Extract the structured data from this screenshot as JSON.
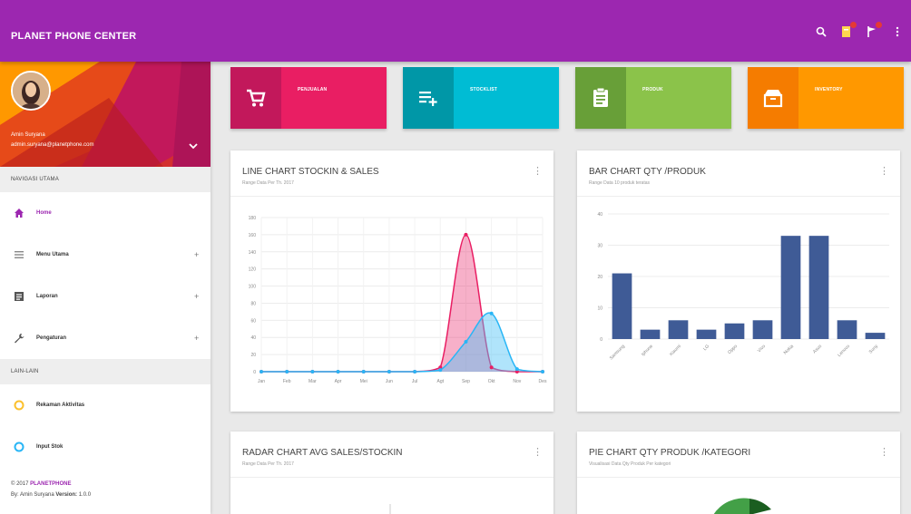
{
  "app": {
    "title": "PLANET PHONE CENTER"
  },
  "topbar": {
    "icons": [
      "search-icon",
      "notification-icon",
      "flag-icon",
      "more-vert-icon"
    ]
  },
  "user": {
    "name": "Amin Suryana",
    "email": "admin.suryana@planetphone.com"
  },
  "sidebar": {
    "section1": "NAVIGASI UTAMA",
    "items": [
      {
        "label": "Home",
        "icon": "home-icon"
      },
      {
        "label": "Menu Utama",
        "icon": "menu-icon",
        "expand": "+"
      },
      {
        "label": "Laporan",
        "icon": "report-icon",
        "expand": "+"
      },
      {
        "label": "Pengaturan",
        "icon": "wrench-icon",
        "expand": "+"
      }
    ],
    "section2": "LAIN-LAIN",
    "others": [
      {
        "label": "Rekaman Aktivitas",
        "icon": "circle-yellow-icon"
      },
      {
        "label": "Input Stok",
        "icon": "circle-blue-icon"
      }
    ],
    "footer_copy": "© 2017 ",
    "footer_brand": "PLANETPHONE",
    "footer_by": "By: Amin Suryana ",
    "footer_version_label": "Version: ",
    "footer_version": "1.0.0"
  },
  "tiles": [
    {
      "label": "PENJUALAN",
      "color": "#e91e63",
      "dark": "#c2185b",
      "icon": "cart-icon"
    },
    {
      "label": "STOCKLIST",
      "color": "#00bcd4",
      "dark": "#0097a7",
      "icon": "playlist-add-icon"
    },
    {
      "label": "PRODUK",
      "color": "#8bc34a",
      "dark": "#689f38",
      "icon": "clipboard-icon"
    },
    {
      "label": "INVENTORY",
      "color": "#ff9800",
      "dark": "#f57c00",
      "icon": "inventory-box-icon"
    }
  ],
  "cards": {
    "line": {
      "title": "LINE CHART STOCKIN & SALES",
      "subtitle": "Range Data Per Th. 2017"
    },
    "bar": {
      "title": "BAR CHART QTY /PRODUK",
      "subtitle": "Range Data 10 produk teratas"
    },
    "radar": {
      "title": "RADAR CHART AVG SALES/STOCKIN",
      "subtitle": "Range Data Per Th. 2017"
    },
    "pie": {
      "title": "PIE CHART QTY PRODUK /KATEGORI",
      "subtitle": "Visualisasi Data Qty Produk Per kategori"
    }
  },
  "chart_data": [
    {
      "type": "line",
      "title": "LINE CHART STOCKIN & SALES",
      "categories": [
        "Jan",
        "Feb",
        "Mar",
        "Apr",
        "Mei",
        "Jun",
        "Jul",
        "Agt",
        "Sep",
        "Okt",
        "Nov",
        "Des"
      ],
      "yticks": [
        0,
        20,
        40,
        60,
        80,
        100,
        120,
        140,
        160,
        180
      ],
      "ylim": [
        0,
        180
      ],
      "series": [
        {
          "values": [
            0,
            0,
            0,
            0,
            0,
            0,
            0,
            5,
            160,
            5,
            0,
            0
          ],
          "color": "#e91e63",
          "fill": "rgba(233,30,99,0.35)"
        },
        {
          "values": [
            0,
            0,
            0,
            0,
            0,
            0,
            0,
            2,
            35,
            68,
            3,
            0
          ],
          "color": "#29b6f6",
          "fill": "rgba(79,195,247,0.45)"
        }
      ]
    },
    {
      "type": "bar",
      "title": "BAR CHART QTY /PRODUK",
      "categories": [
        "Samsung",
        "Iphone",
        "Xiaomi",
        "LG",
        "Oppo",
        "Vivo",
        "Nokia",
        "Asus",
        "Lenovo",
        "Sony"
      ],
      "values": [
        21,
        3,
        6,
        3,
        5,
        6,
        33,
        33,
        6,
        2
      ],
      "yticks": [
        0,
        10,
        20,
        30,
        40
      ],
      "ylim": [
        0,
        40
      ],
      "color": "#3f5b96"
    }
  ]
}
